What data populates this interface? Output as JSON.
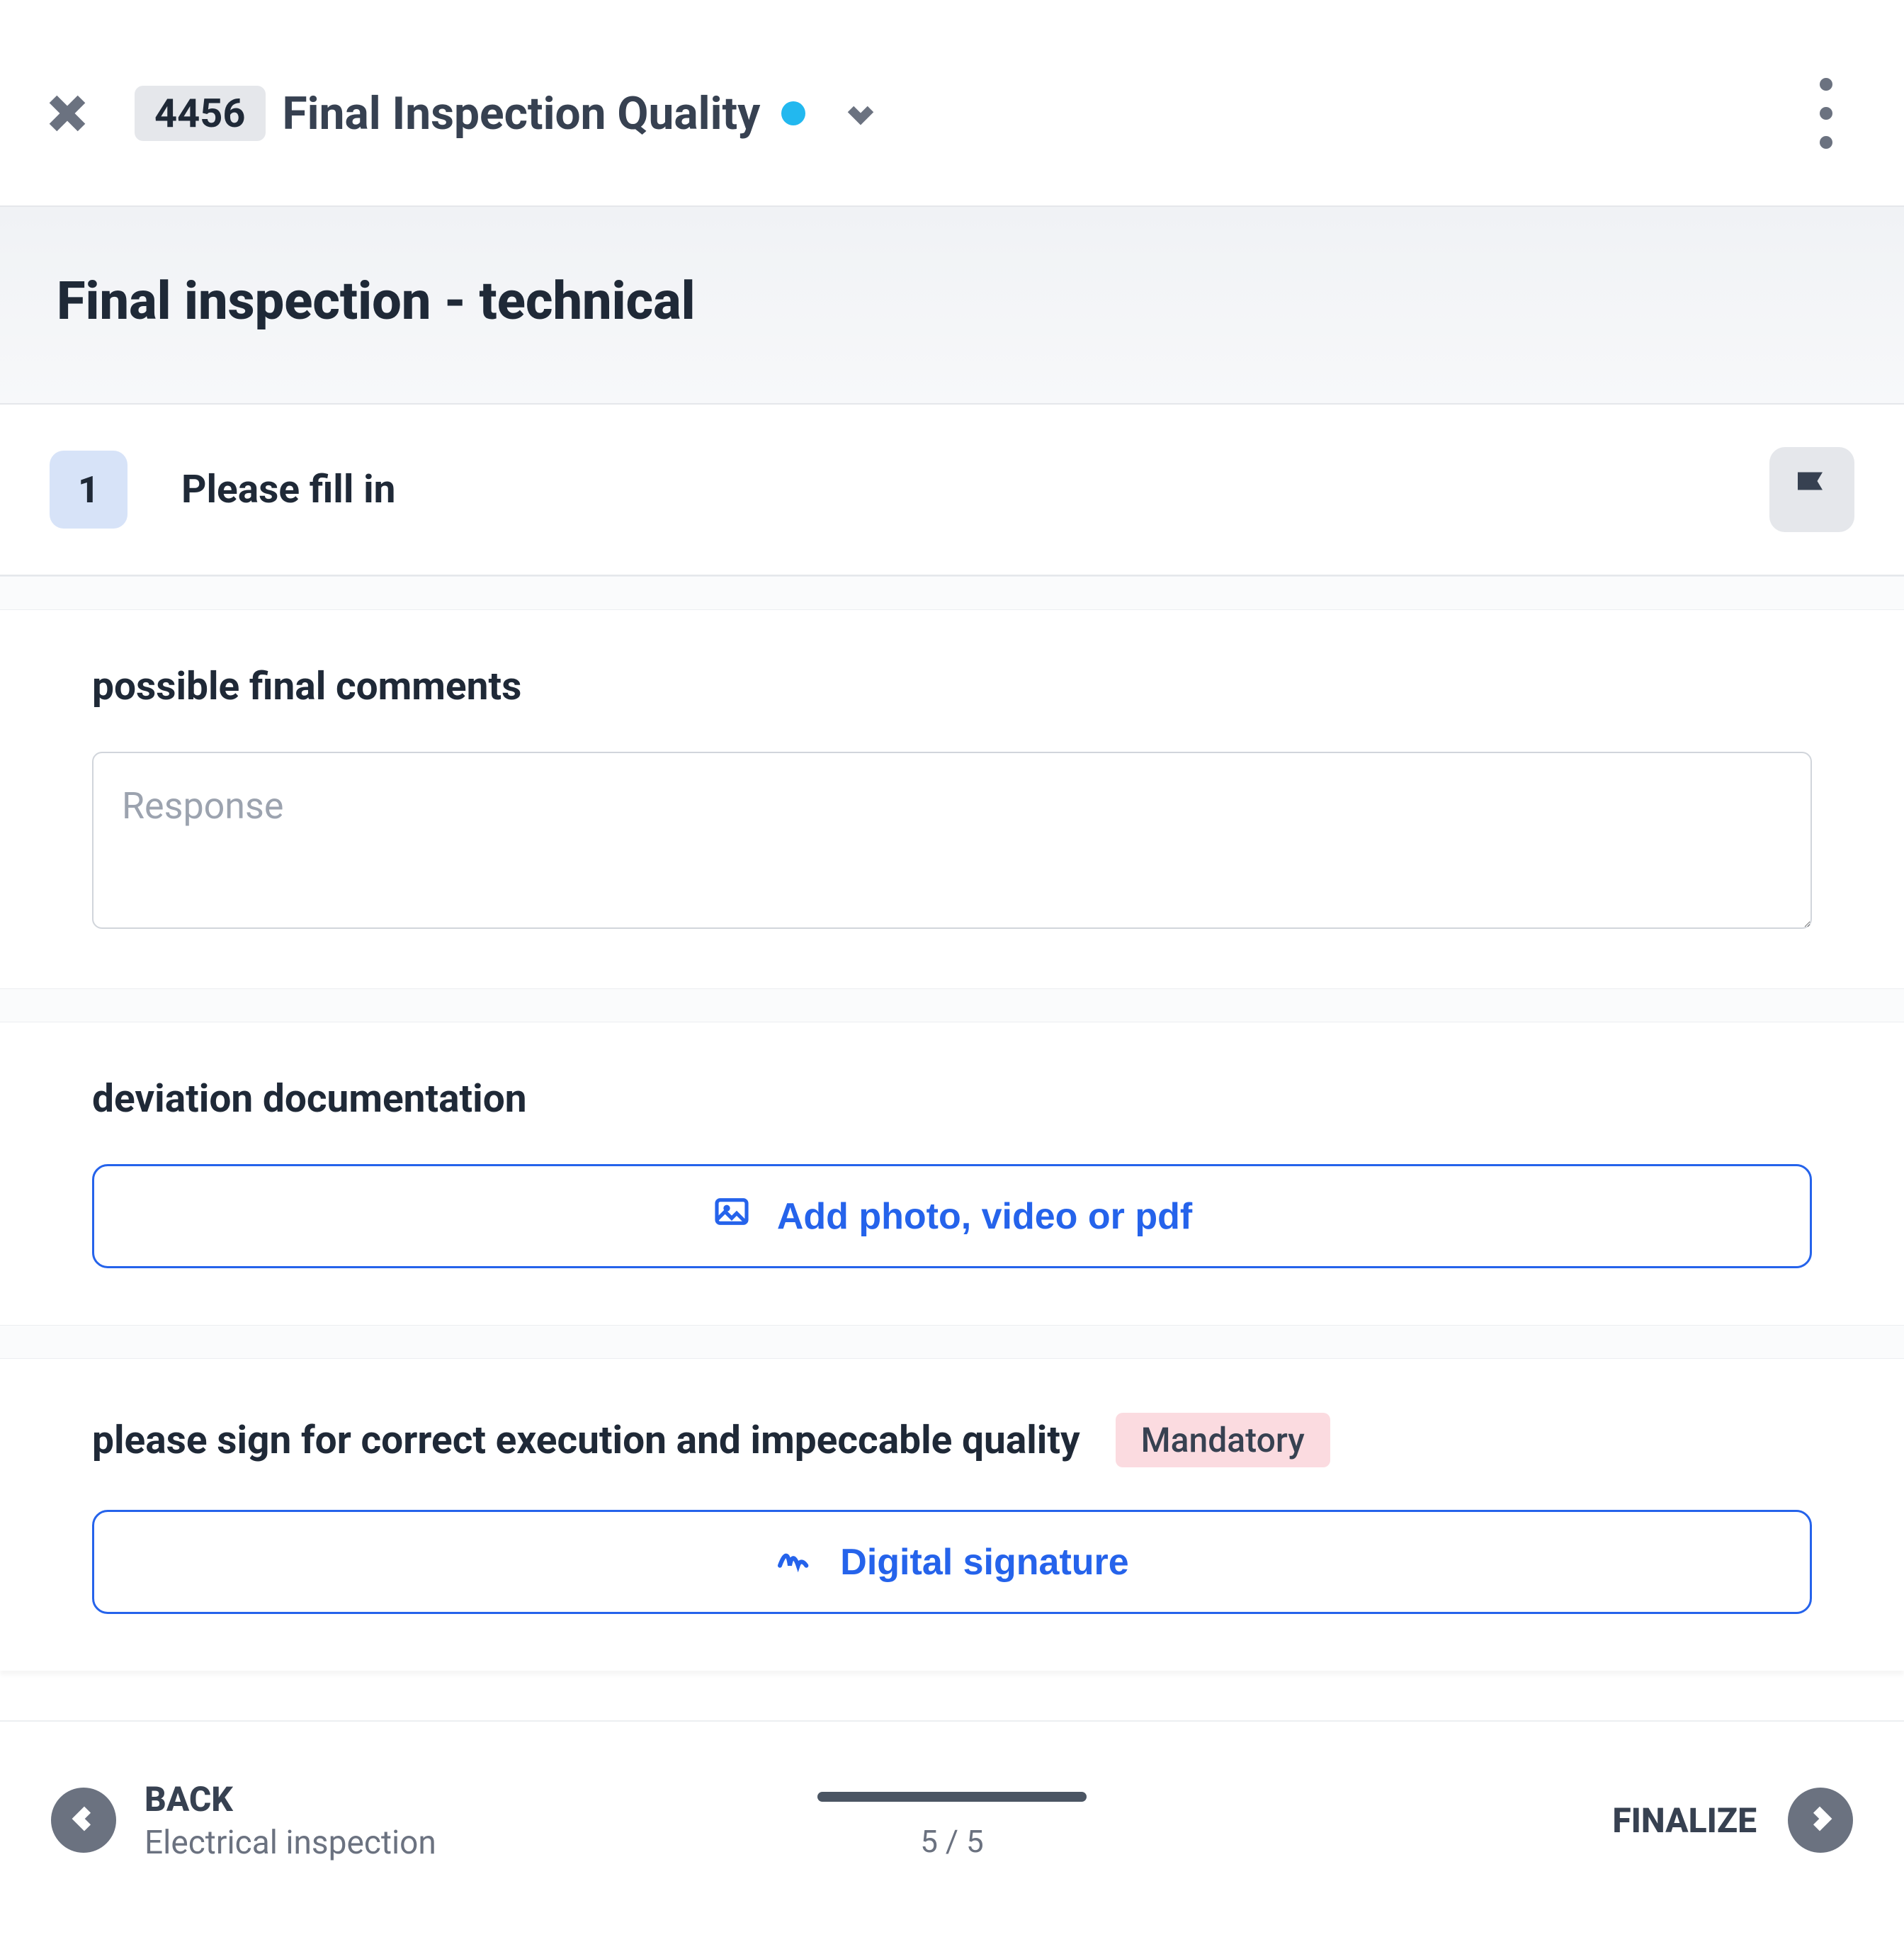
{
  "header": {
    "id_badge": "4456",
    "title": "Final Inspection Quality",
    "status_color": "#22b8ef"
  },
  "heading": "Final inspection - technical",
  "step": {
    "number": "1",
    "title": "Please fill in"
  },
  "cards": {
    "comments": {
      "label": "possible final comments",
      "placeholder": "Response"
    },
    "deviation": {
      "label": "deviation documentation",
      "button": "Add photo, video or pdf"
    },
    "signature": {
      "label": "please sign for correct execution and impeccable quality",
      "mandatory": "Mandatory",
      "button": "Digital signature"
    }
  },
  "footer": {
    "back_label": "BACK",
    "back_sub": "Electrical inspection",
    "progress_text": "5 / 5",
    "finalize_label": "FINALIZE"
  }
}
